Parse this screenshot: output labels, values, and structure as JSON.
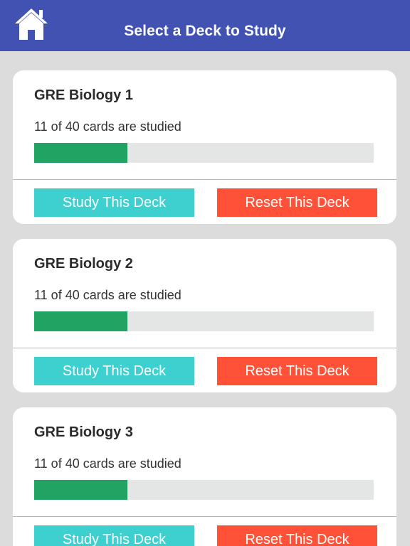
{
  "header": {
    "title": "Select a Deck to Study",
    "home_icon": "home-icon"
  },
  "colors": {
    "header_bg": "#4152b3",
    "progress_fill": "#21a463",
    "study_button": "#3ecfcf",
    "reset_button": "#fe5137"
  },
  "decks": [
    {
      "title": "GRE Biology 1",
      "progress_text": "11 of 40 cards are studied",
      "studied": 11,
      "total": 40,
      "study_label": "Study This Deck",
      "reset_label": "Reset This Deck"
    },
    {
      "title": "GRE Biology 2",
      "progress_text": "11 of 40 cards are studied",
      "studied": 11,
      "total": 40,
      "study_label": "Study This Deck",
      "reset_label": "Reset This Deck"
    },
    {
      "title": "GRE Biology 3",
      "progress_text": "11 of 40 cards are studied",
      "studied": 11,
      "total": 40,
      "study_label": "Study This Deck",
      "reset_label": "Reset This Deck"
    }
  ]
}
